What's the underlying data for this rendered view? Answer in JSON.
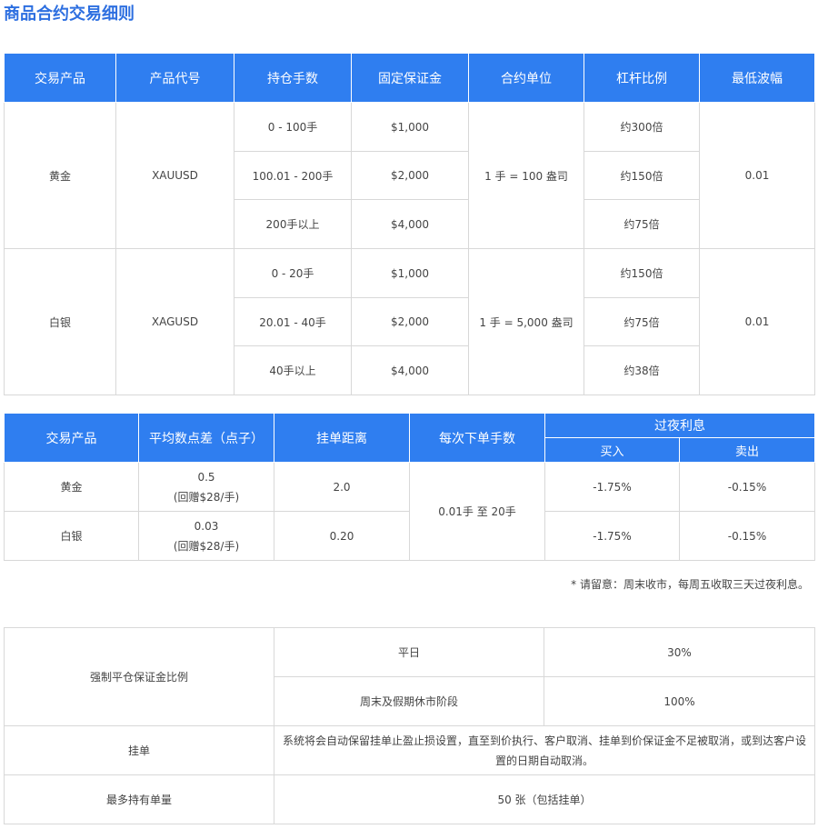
{
  "page": {
    "title": "商品合约交易细则"
  },
  "table1": {
    "headers": [
      "交易产品",
      "产品代号",
      "持仓手数",
      "固定保证金",
      "合约单位",
      "杠杆比例",
      "最低波幅"
    ],
    "products": [
      {
        "name": "黄金",
        "code": "XAUUSD",
        "contract": "1 手 = 100 盎司",
        "min_tick": "0.01",
        "tiers": [
          {
            "lots": "0 - 100手",
            "margin": "$1,000",
            "leverage": "约300倍"
          },
          {
            "lots": "100.01 - 200手",
            "margin": "$2,000",
            "leverage": "约150倍"
          },
          {
            "lots": "200手以上",
            "margin": "$4,000",
            "leverage": "约75倍"
          }
        ]
      },
      {
        "name": "白银",
        "code": "XAGUSD",
        "contract": "1 手 = 5,000 盎司",
        "min_tick": "0.01",
        "tiers": [
          {
            "lots": "0 - 20手",
            "margin": "$1,000",
            "leverage": "约150倍"
          },
          {
            "lots": "20.01 - 40手",
            "margin": "$2,000",
            "leverage": "约75倍"
          },
          {
            "lots": "40手以上",
            "margin": "$4,000",
            "leverage": "约38倍"
          }
        ]
      }
    ]
  },
  "table2": {
    "headers": {
      "product": "交易产品",
      "spread": "平均数点差（点子）",
      "order_distance": "挂单距离",
      "lots_per_order": "每次下单手数",
      "overnight": "过夜利息",
      "buy": "买入",
      "sell": "卖出"
    },
    "lots_per_order": "0.01手 至 20手",
    "rows": [
      {
        "product": "黄金",
        "spread": "0.5",
        "rebate": "(回赠$28/手)",
        "order_distance": "2.0",
        "buy": "-1.75%",
        "sell": "-0.15%"
      },
      {
        "product": "白银",
        "spread": "0.03",
        "rebate": "(回赠$28/手)",
        "order_distance": "0.20",
        "buy": "-1.75%",
        "sell": "-0.15%"
      }
    ]
  },
  "note": "* 请留意：周末收市，每周五收取三天过夜利息。",
  "table3": {
    "margin_call": {
      "label": "强制平仓保证金比例",
      "rows": [
        {
          "period": "平日",
          "value": "30%"
        },
        {
          "period": "周末及假期休市阶段",
          "value": "100%"
        }
      ]
    },
    "pending": {
      "label": "挂单",
      "text": "系统将会自动保留挂单止盈止损设置，直至到价执行、客户取消、挂单到价保证金不足被取消，或到达客户设置的日期自动取消。"
    },
    "max_hold": {
      "label": "最多持有单量",
      "value": "50 张（包括挂单）"
    }
  }
}
